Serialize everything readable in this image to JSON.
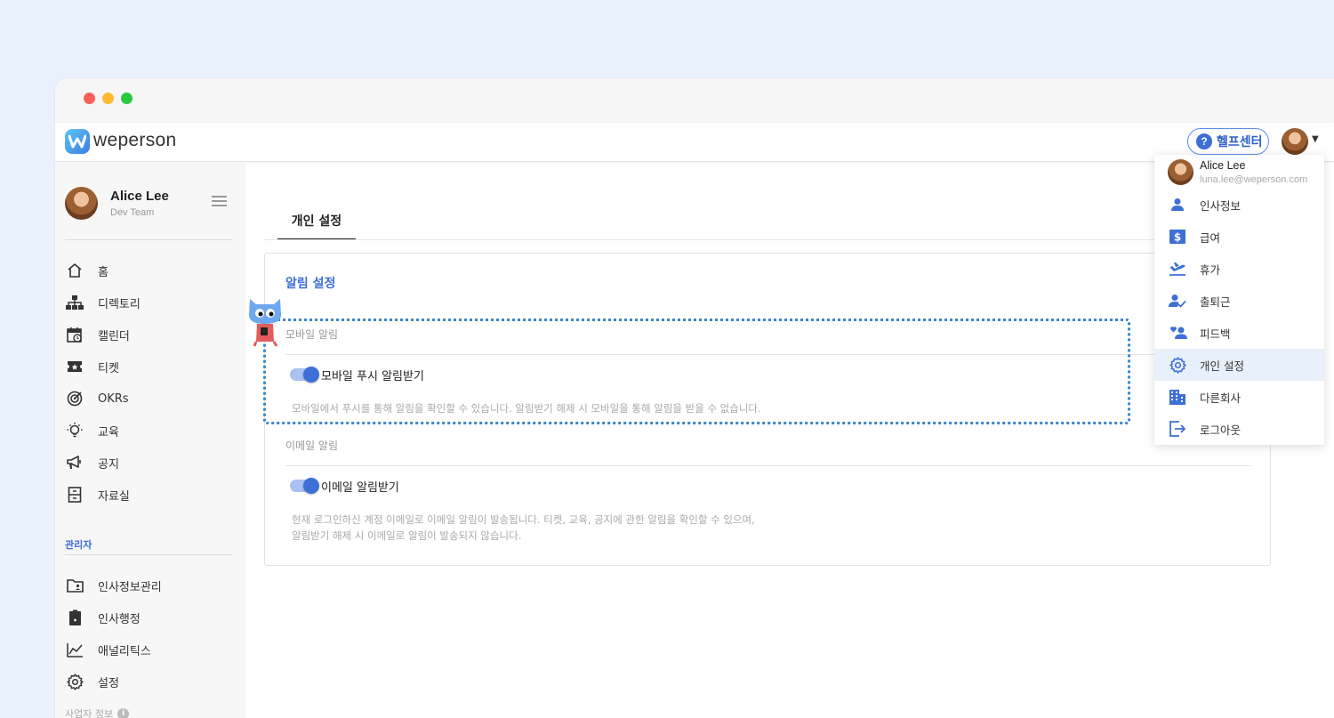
{
  "app": {
    "brand": "weperson",
    "help_label": "헬프센터",
    "help_icon": "?"
  },
  "user": {
    "name": "Alice Lee",
    "team": "Dev Team",
    "email": "luna.lee@weperson.com"
  },
  "sidebar": {
    "items": [
      {
        "label": "홈",
        "icon": "home-icon"
      },
      {
        "label": "디렉토리",
        "icon": "org-chart-icon"
      },
      {
        "label": "캘린더",
        "icon": "calendar-icon"
      },
      {
        "label": "티켓",
        "icon": "ticket-icon"
      },
      {
        "label": "OKRs",
        "icon": "target-icon"
      },
      {
        "label": "교육",
        "icon": "lightbulb-icon"
      },
      {
        "label": "공지",
        "icon": "megaphone-icon"
      },
      {
        "label": "자료실",
        "icon": "cabinet-icon"
      }
    ],
    "admin_section_label": "관리자",
    "admin_items": [
      {
        "label": "인사정보관리",
        "icon": "id-folder-icon"
      },
      {
        "label": "인사행정",
        "icon": "clipboard-icon"
      },
      {
        "label": "애널리틱스",
        "icon": "line-chart-icon"
      },
      {
        "label": "설정",
        "icon": "gear-icon"
      }
    ],
    "biz_info_label": "사업자 정보",
    "biz_info_icon": "i"
  },
  "main": {
    "tab_label": "개인 설정",
    "card_title": "알림 설정",
    "mobile": {
      "group_label": "모바일 알림",
      "toggle_label": "모바일 푸시 알림받기",
      "toggle_on": true,
      "description": "모바일에서 푸시를 통해 알림을 확인할 수 있습니다. 알림받기 해제 시 모바일을 통해 알림을 받을 수 없습니다."
    },
    "email": {
      "group_label": "이메일 알림",
      "toggle_label": "이메일 알림받기",
      "toggle_on": true,
      "description_line1": "현재 로그인하신 계정 이메일로 이메일 알림이 발송됩니다. 티켓, 교육, 공지에 관한 알림을 확인할 수 있으며,",
      "description_line2": "알림받기 해제 시 이메일로 알림이 발송되지 않습니다."
    }
  },
  "dropdown": {
    "items": [
      {
        "label": "인사정보",
        "icon": "person-icon",
        "active": false
      },
      {
        "label": "급여",
        "icon": "dollar-icon",
        "active": false
      },
      {
        "label": "휴가",
        "icon": "airplane-icon",
        "active": false
      },
      {
        "label": "출퇴근",
        "icon": "person-check-icon",
        "active": false
      },
      {
        "label": "피드백",
        "icon": "people-heart-icon",
        "active": false
      },
      {
        "label": "개인 설정",
        "icon": "gear-icon",
        "active": true
      },
      {
        "label": "다른회사",
        "icon": "building-icon",
        "active": false
      },
      {
        "label": "로그아웃",
        "icon": "logout-icon",
        "active": false
      }
    ]
  },
  "colors": {
    "accent": "#3d6fd6",
    "toggle_track": "#a9c2f1",
    "highlight_border": "#3a86cf",
    "active_menu_bg": "#e8f0fb"
  }
}
